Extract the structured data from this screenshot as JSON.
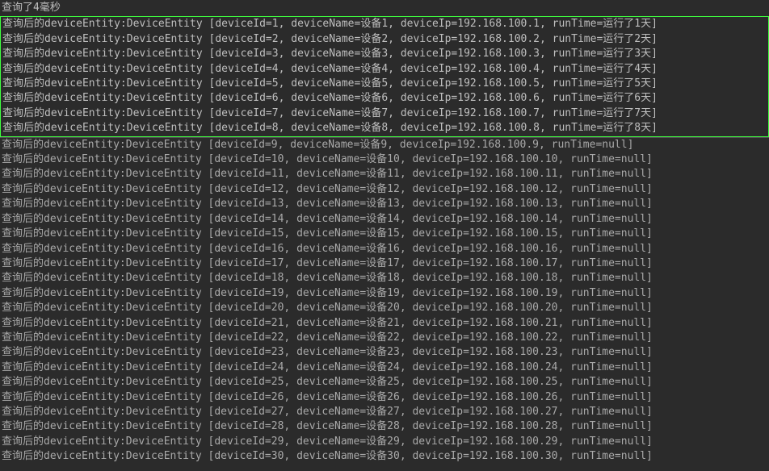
{
  "header": "查询了4毫秒",
  "prefix": "查询后的deviceEntity:DeviceEntity",
  "highlighted": [
    {
      "id": 1,
      "name": "设备1",
      "ip": "192.168.100.1",
      "runTime": "运行了1天"
    },
    {
      "id": 2,
      "name": "设备2",
      "ip": "192.168.100.2",
      "runTime": "运行了2天"
    },
    {
      "id": 3,
      "name": "设备3",
      "ip": "192.168.100.3",
      "runTime": "运行了3天"
    },
    {
      "id": 4,
      "name": "设备4",
      "ip": "192.168.100.4",
      "runTime": "运行了4天"
    },
    {
      "id": 5,
      "name": "设备5",
      "ip": "192.168.100.5",
      "runTime": "运行了5天"
    },
    {
      "id": 6,
      "name": "设备6",
      "ip": "192.168.100.6",
      "runTime": "运行了6天"
    },
    {
      "id": 7,
      "name": "设备7",
      "ip": "192.168.100.7",
      "runTime": "运行了7天"
    },
    {
      "id": 8,
      "name": "设备8",
      "ip": "192.168.100.8",
      "runTime": "运行了8天"
    }
  ],
  "regular": [
    {
      "id": 9,
      "name": "设备9",
      "ip": "192.168.100.9",
      "runTime": "null"
    },
    {
      "id": 10,
      "name": "设备10",
      "ip": "192.168.100.10",
      "runTime": "null"
    },
    {
      "id": 11,
      "name": "设备11",
      "ip": "192.168.100.11",
      "runTime": "null"
    },
    {
      "id": 12,
      "name": "设备12",
      "ip": "192.168.100.12",
      "runTime": "null"
    },
    {
      "id": 13,
      "name": "设备13",
      "ip": "192.168.100.13",
      "runTime": "null"
    },
    {
      "id": 14,
      "name": "设备14",
      "ip": "192.168.100.14",
      "runTime": "null"
    },
    {
      "id": 15,
      "name": "设备15",
      "ip": "192.168.100.15",
      "runTime": "null"
    },
    {
      "id": 16,
      "name": "设备16",
      "ip": "192.168.100.16",
      "runTime": "null"
    },
    {
      "id": 17,
      "name": "设备17",
      "ip": "192.168.100.17",
      "runTime": "null"
    },
    {
      "id": 18,
      "name": "设备18",
      "ip": "192.168.100.18",
      "runTime": "null"
    },
    {
      "id": 19,
      "name": "设备19",
      "ip": "192.168.100.19",
      "runTime": "null"
    },
    {
      "id": 20,
      "name": "设备20",
      "ip": "192.168.100.20",
      "runTime": "null"
    },
    {
      "id": 21,
      "name": "设备21",
      "ip": "192.168.100.21",
      "runTime": "null"
    },
    {
      "id": 22,
      "name": "设备22",
      "ip": "192.168.100.22",
      "runTime": "null"
    },
    {
      "id": 23,
      "name": "设备23",
      "ip": "192.168.100.23",
      "runTime": "null"
    },
    {
      "id": 24,
      "name": "设备24",
      "ip": "192.168.100.24",
      "runTime": "null"
    },
    {
      "id": 25,
      "name": "设备25",
      "ip": "192.168.100.25",
      "runTime": "null"
    },
    {
      "id": 26,
      "name": "设备26",
      "ip": "192.168.100.26",
      "runTime": "null"
    },
    {
      "id": 27,
      "name": "设备27",
      "ip": "192.168.100.27",
      "runTime": "null"
    },
    {
      "id": 28,
      "name": "设备28",
      "ip": "192.168.100.28",
      "runTime": "null"
    },
    {
      "id": 29,
      "name": "设备29",
      "ip": "192.168.100.29",
      "runTime": "null"
    },
    {
      "id": 30,
      "name": "设备30",
      "ip": "192.168.100.30",
      "runTime": "null"
    }
  ]
}
